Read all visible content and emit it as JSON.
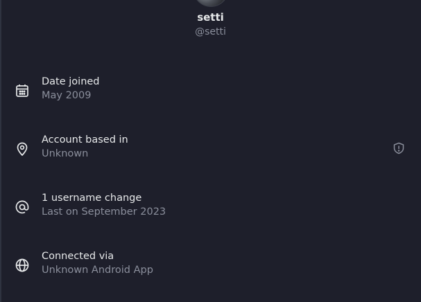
{
  "profile": {
    "display_name": "setti",
    "handle": "@setti"
  },
  "rows": [
    {
      "icon": "calendar-icon",
      "title": "Date joined",
      "subtitle": "May 2009"
    },
    {
      "icon": "location-pin-icon",
      "title": "Account based in",
      "subtitle": "Unknown",
      "trailing_icon": "shield-info-icon"
    },
    {
      "icon": "at-sign-icon",
      "title": "1 username change",
      "subtitle": "Last on September 2023"
    },
    {
      "icon": "globe-icon",
      "title": "Connected via",
      "subtitle": "Unknown Android App"
    }
  ],
  "colors": {
    "background": "#1e1f2b",
    "text_primary": "#e7e9ea",
    "text_secondary": "#8b8f9c"
  }
}
